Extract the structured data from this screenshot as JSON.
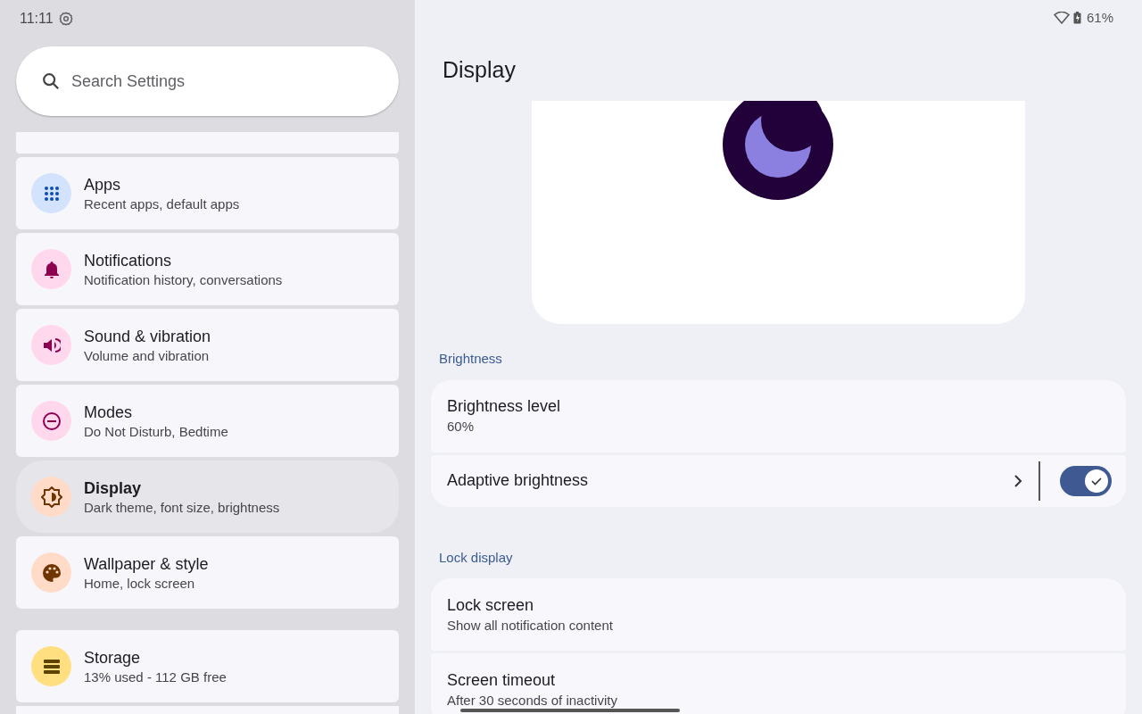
{
  "status_bar": {
    "time": "11:11",
    "battery": "61%"
  },
  "sidebar": {
    "search": {
      "placeholder": "Search Settings"
    },
    "items": [
      {
        "kind": "cut"
      },
      {
        "kind": "item",
        "title": "Apps",
        "subtitle": "Recent apps, default apps",
        "color": "#d3e3fd",
        "selected": false
      },
      {
        "kind": "item",
        "title": "Notifications",
        "subtitle": "Notification history, conversations",
        "color": "#ffd8ee",
        "selected": false
      },
      {
        "kind": "item",
        "title": "Sound & vibration",
        "subtitle": "Volume and vibration",
        "color": "#ffd8ee",
        "selected": false
      },
      {
        "kind": "item",
        "title": "Modes",
        "subtitle": "Do Not Disturb, Bedtime",
        "color": "#ffd8ee",
        "selected": false
      },
      {
        "kind": "item",
        "title": "Display",
        "subtitle": "Dark theme, font size, brightness",
        "color": "#ffdbc8",
        "selected": true
      },
      {
        "kind": "item",
        "title": "Wallpaper & style",
        "subtitle": "Home, lock screen",
        "color": "#ffdbc8",
        "selected": false
      },
      {
        "kind": "gap"
      },
      {
        "kind": "item",
        "title": "Storage",
        "subtitle": "13% used - 112 GB free",
        "color": "#ffdf80",
        "selected": false
      },
      {
        "kind": "cut"
      }
    ]
  },
  "page": {
    "title": "Display",
    "sections": [
      {
        "header": "Brightness",
        "rows": [
          {
            "kind": "text",
            "title": "Brightness level",
            "subtitle": "60%"
          },
          {
            "kind": "switch",
            "title": "Adaptive brightness",
            "on": true
          }
        ]
      },
      {
        "header": "Lock display",
        "rows": [
          {
            "kind": "text",
            "title": "Lock screen",
            "subtitle": "Show all notification content"
          },
          {
            "kind": "text",
            "title": "Screen timeout",
            "subtitle": "After 30 seconds of inactivity"
          }
        ]
      }
    ]
  }
}
